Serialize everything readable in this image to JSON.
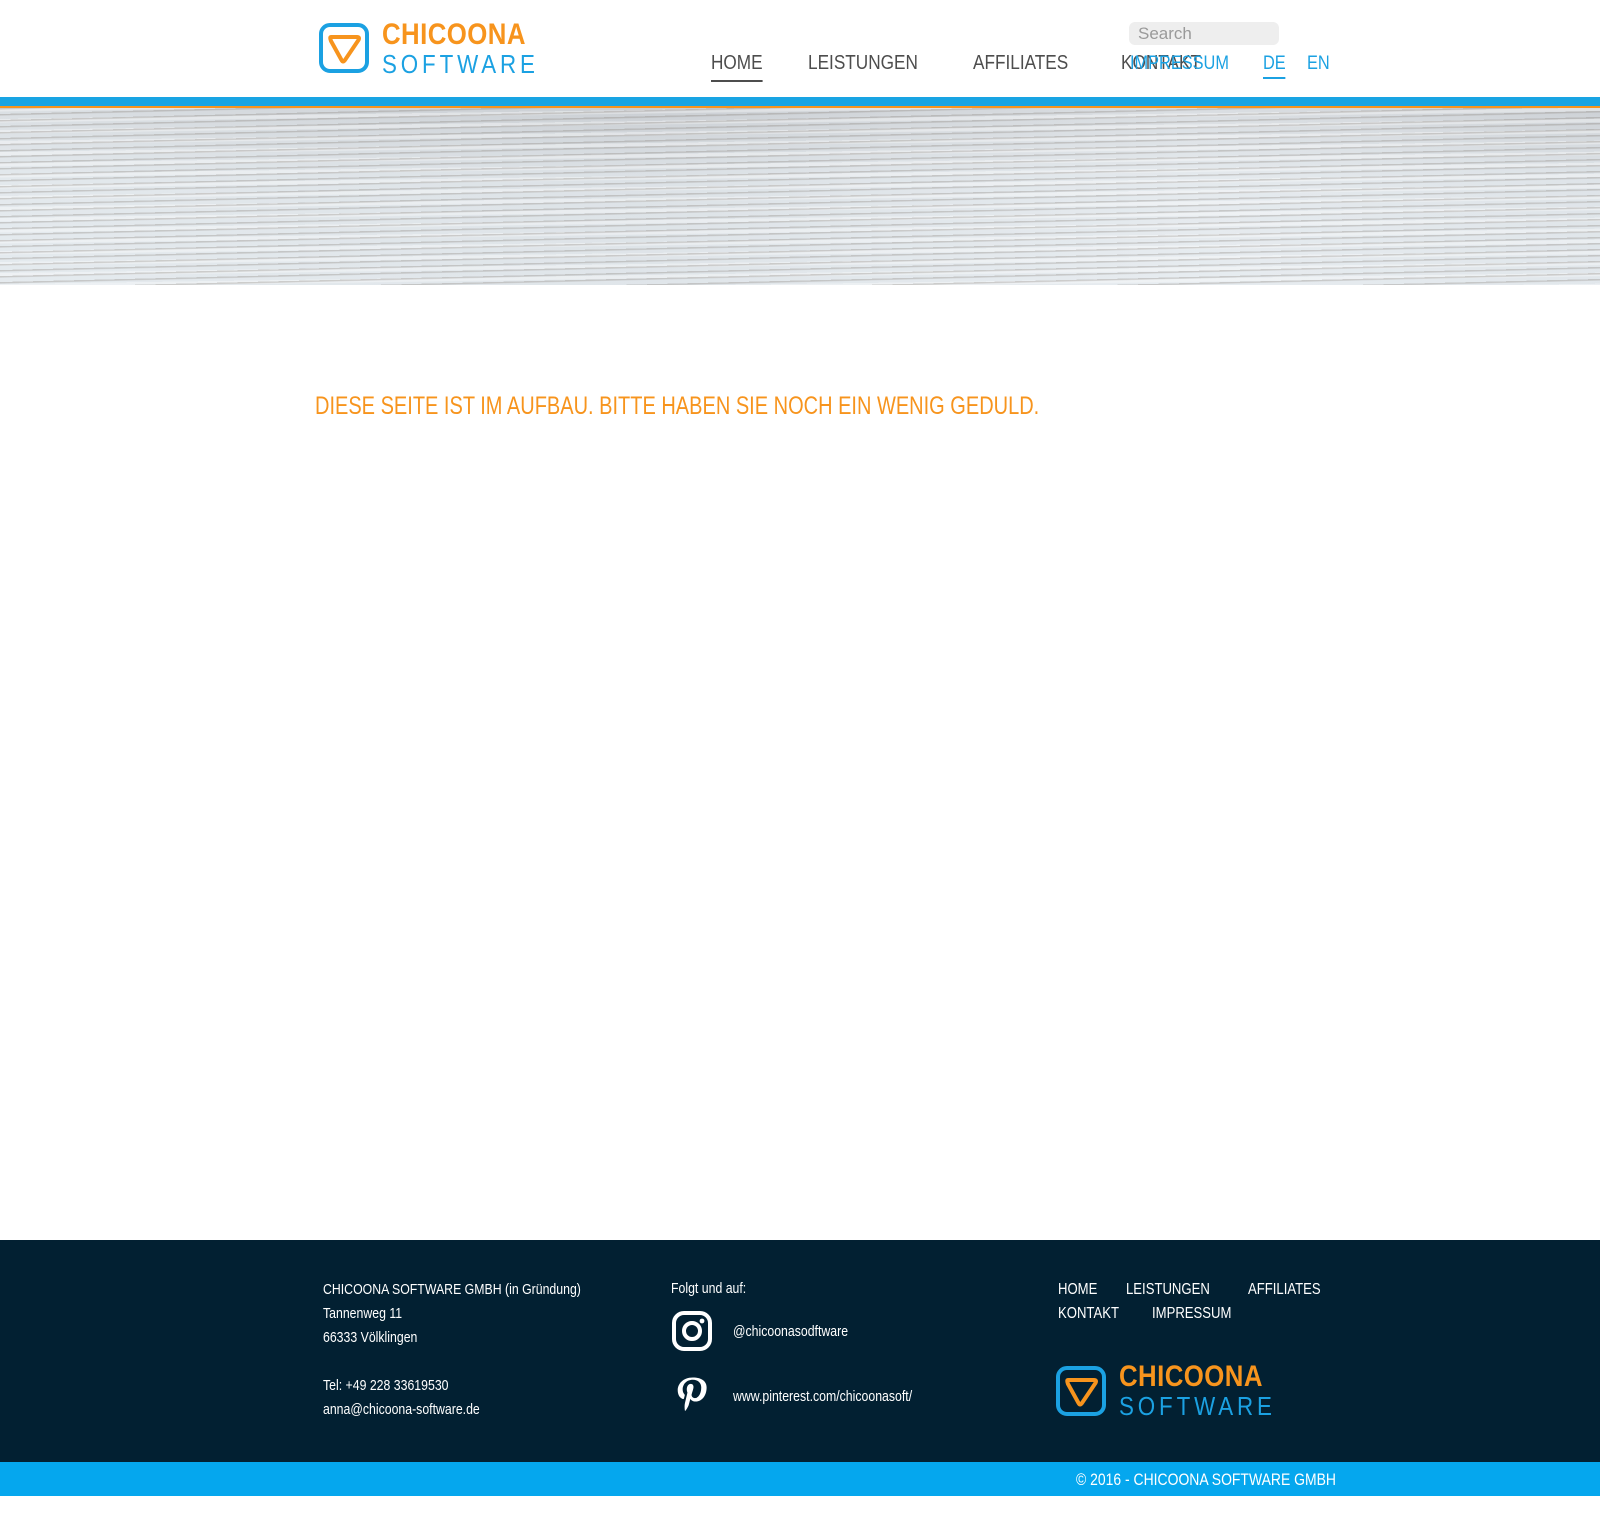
{
  "brand": {
    "name_line1": "CHICOONA",
    "name_line2": "SOFTWARE",
    "orange": "#f7941d",
    "blue": "#1ba1e2"
  },
  "header": {
    "search_placeholder": "Search",
    "nav": [
      "HOME",
      "LEISTUNGEN",
      "AFFILIATES",
      "KONTAKT"
    ],
    "active_nav": "HOME",
    "meta": [
      "IMPRESSUM",
      "DE",
      "EN"
    ],
    "active_lang": "DE"
  },
  "content": {
    "notice": "DIESE SEITE IST IM AUFBAU. BITTE HABEN SIE NOCH EIN WENIG GEDULD."
  },
  "footer": {
    "address": {
      "company": "CHICOONA SOFTWARE GMBH (in Gründung)",
      "street": "Tannenweg 11",
      "city": "66333 Völklingen",
      "tel": "Tel: +49 228 33619530",
      "email": "anna@chicoona-software.de"
    },
    "social": {
      "heading": "Folgt und auf:",
      "instagram": "@chicoonasodftware",
      "pinterest": "www.pinterest.com/chicoonasoft/"
    },
    "nav": [
      "HOME",
      "LEISTUNGEN",
      "AFFILIATES",
      "KONTAKT",
      "IMPRESSUM"
    ],
    "copyright": "© 2016 - CHICOONA SOFTWARE GMBH",
    "background": "#022032",
    "bar_color": "#05a7ee"
  }
}
